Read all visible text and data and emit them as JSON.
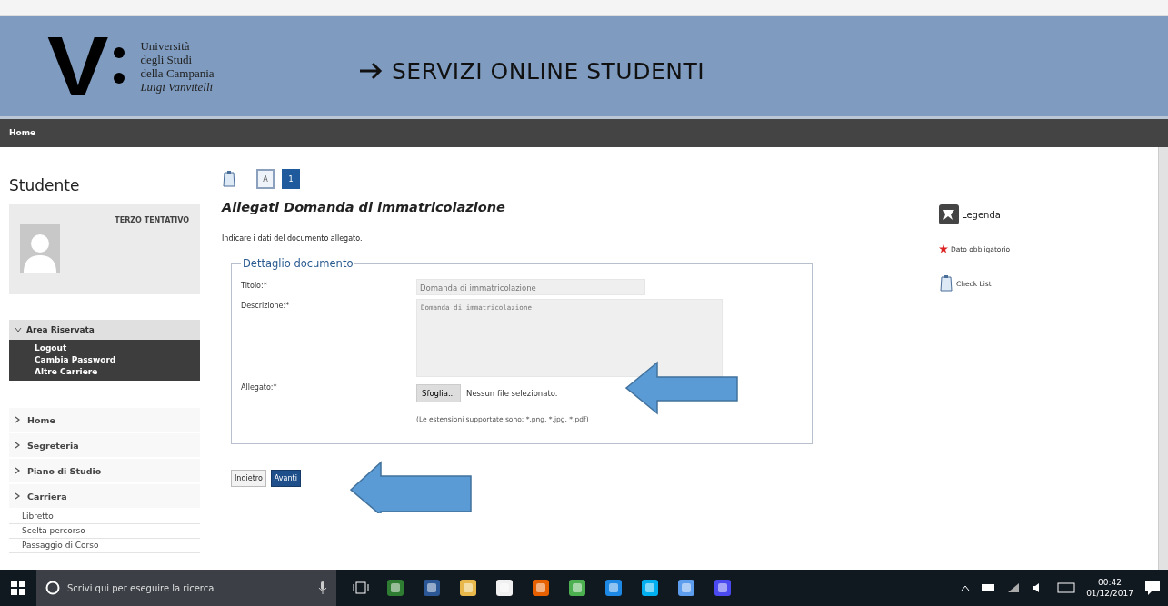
{
  "header": {
    "logo_letter": "V",
    "logo_lines": [
      "Università",
      "degli Studi",
      "della Campania",
      "Luigi Vanvitelli"
    ],
    "title": "SERVIZI ONLINE STUDENTI"
  },
  "nav": [
    {
      "label": "Home"
    }
  ],
  "steps": [
    {
      "label": "A",
      "selected": false
    },
    {
      "label": "1",
      "selected": true
    }
  ],
  "sidebar": {
    "title": "Studente",
    "user_name": "TERZO TENTATIVO",
    "reserved": {
      "label": "Area Riservata",
      "items": [
        "Logout",
        "Cambia Password",
        "Altre Carriere"
      ]
    },
    "menu": [
      {
        "label": "Home"
      },
      {
        "label": "Segreteria"
      },
      {
        "label": "Piano di Studio"
      },
      {
        "label": "Carriera",
        "children": [
          "Libretto",
          "Scelta percorso",
          "Passaggio di Corso"
        ]
      }
    ]
  },
  "form": {
    "title": "Allegati Domanda di immatricolazione",
    "instruction": "Indicare i dati del documento allegato.",
    "fieldset": "Dettaglio documento",
    "fields": [
      {
        "kind": "text",
        "label": "Titolo:*",
        "value": "Domanda di immatricolazione",
        "disabled": true
      },
      {
        "kind": "textarea",
        "label": "Descrizione:*",
        "value": "Domanda di immatricolazione",
        "disabled": true
      },
      {
        "kind": "file",
        "label": "Allegato:*",
        "button": "Sfoglia...",
        "status": "Nessun file selezionato.",
        "hint": "(Le estensioni supportate sono: *.png, *.jpg, *.pdf)"
      }
    ],
    "buttons": [
      {
        "label": "Indietro",
        "primary": false
      },
      {
        "label": "Avanti",
        "primary": true
      }
    ]
  },
  "legend": {
    "title": "Legenda",
    "items": [
      {
        "kind": "required",
        "label": "Dato obbligatorio"
      },
      {
        "kind": "checklist",
        "label": "Check List"
      }
    ]
  },
  "taskbar": {
    "search_placeholder": "Scrivi qui per eseguire la ricerca",
    "time": "00:42",
    "date": "01/12/2017"
  }
}
